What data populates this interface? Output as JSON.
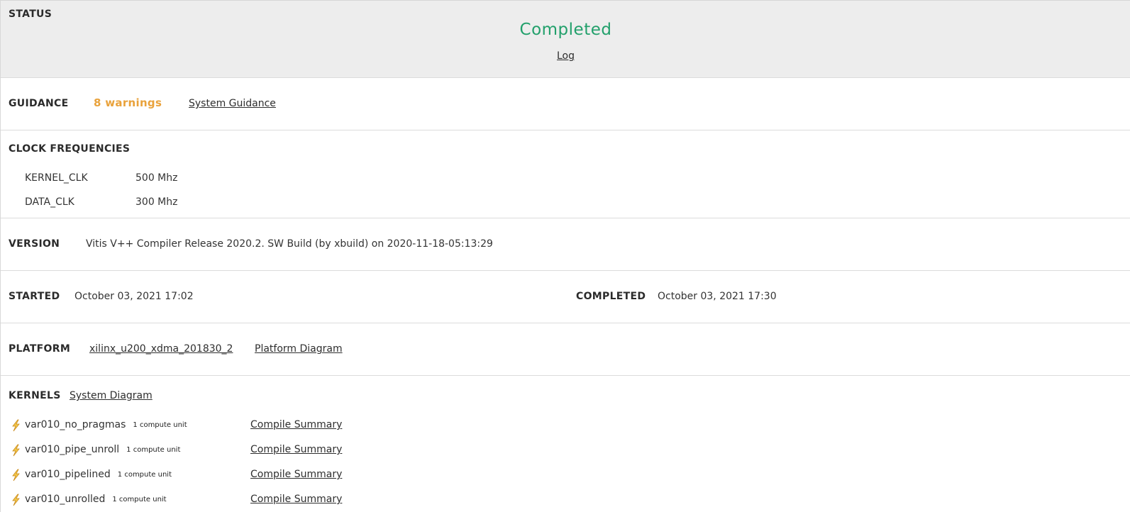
{
  "status": {
    "label": "STATUS",
    "value": "Completed",
    "log_link": "Log",
    "value_color": "#22a06b"
  },
  "guidance": {
    "label": "GUIDANCE",
    "warnings": "8 warnings",
    "warnings_color": "#e9a23b",
    "link": "System Guidance"
  },
  "clock_frequencies": {
    "label": "CLOCK FREQUENCIES",
    "rows": [
      {
        "name": "KERNEL_CLK",
        "value": "500 Mhz"
      },
      {
        "name": "DATA_CLK",
        "value": "300 Mhz"
      }
    ]
  },
  "version": {
    "label": "VERSION",
    "value": "Vitis V++ Compiler Release 2020.2. SW Build (by xbuild) on 2020-11-18-05:13:29"
  },
  "times": {
    "started_label": "STARTED",
    "started_value": "October 03, 2021 17:02",
    "completed_label": "COMPLETED",
    "completed_value": "October 03, 2021 17:30"
  },
  "platform": {
    "label": "PLATFORM",
    "name_link": "xilinx_u200_xdma_201830_2",
    "diagram_link": "Platform Diagram"
  },
  "kernels": {
    "label": "KERNELS",
    "diagram_link": "System Diagram",
    "icon": "lightning-icon",
    "items": [
      {
        "name": "var010_no_pragmas",
        "units": "1 compute unit",
        "link": "Compile Summary"
      },
      {
        "name": "var010_pipe_unroll",
        "units": "1 compute unit",
        "link": "Compile Summary"
      },
      {
        "name": "var010_pipelined",
        "units": "1 compute unit",
        "link": "Compile Summary"
      },
      {
        "name": "var010_unrolled",
        "units": "1 compute unit",
        "link": "Compile Summary"
      }
    ]
  }
}
